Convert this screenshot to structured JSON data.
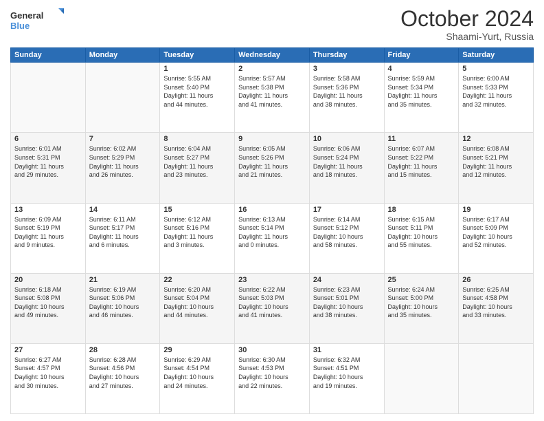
{
  "header": {
    "logo_line1": "General",
    "logo_line2": "Blue",
    "month": "October 2024",
    "location": "Shaami-Yurt, Russia"
  },
  "days_of_week": [
    "Sunday",
    "Monday",
    "Tuesday",
    "Wednesday",
    "Thursday",
    "Friday",
    "Saturday"
  ],
  "weeks": [
    [
      {
        "day": "",
        "content": ""
      },
      {
        "day": "",
        "content": ""
      },
      {
        "day": "1",
        "content": "Sunrise: 5:55 AM\nSunset: 5:40 PM\nDaylight: 11 hours\nand 44 minutes."
      },
      {
        "day": "2",
        "content": "Sunrise: 5:57 AM\nSunset: 5:38 PM\nDaylight: 11 hours\nand 41 minutes."
      },
      {
        "day": "3",
        "content": "Sunrise: 5:58 AM\nSunset: 5:36 PM\nDaylight: 11 hours\nand 38 minutes."
      },
      {
        "day": "4",
        "content": "Sunrise: 5:59 AM\nSunset: 5:34 PM\nDaylight: 11 hours\nand 35 minutes."
      },
      {
        "day": "5",
        "content": "Sunrise: 6:00 AM\nSunset: 5:33 PM\nDaylight: 11 hours\nand 32 minutes."
      }
    ],
    [
      {
        "day": "6",
        "content": "Sunrise: 6:01 AM\nSunset: 5:31 PM\nDaylight: 11 hours\nand 29 minutes."
      },
      {
        "day": "7",
        "content": "Sunrise: 6:02 AM\nSunset: 5:29 PM\nDaylight: 11 hours\nand 26 minutes."
      },
      {
        "day": "8",
        "content": "Sunrise: 6:04 AM\nSunset: 5:27 PM\nDaylight: 11 hours\nand 23 minutes."
      },
      {
        "day": "9",
        "content": "Sunrise: 6:05 AM\nSunset: 5:26 PM\nDaylight: 11 hours\nand 21 minutes."
      },
      {
        "day": "10",
        "content": "Sunrise: 6:06 AM\nSunset: 5:24 PM\nDaylight: 11 hours\nand 18 minutes."
      },
      {
        "day": "11",
        "content": "Sunrise: 6:07 AM\nSunset: 5:22 PM\nDaylight: 11 hours\nand 15 minutes."
      },
      {
        "day": "12",
        "content": "Sunrise: 6:08 AM\nSunset: 5:21 PM\nDaylight: 11 hours\nand 12 minutes."
      }
    ],
    [
      {
        "day": "13",
        "content": "Sunrise: 6:09 AM\nSunset: 5:19 PM\nDaylight: 11 hours\nand 9 minutes."
      },
      {
        "day": "14",
        "content": "Sunrise: 6:11 AM\nSunset: 5:17 PM\nDaylight: 11 hours\nand 6 minutes."
      },
      {
        "day": "15",
        "content": "Sunrise: 6:12 AM\nSunset: 5:16 PM\nDaylight: 11 hours\nand 3 minutes."
      },
      {
        "day": "16",
        "content": "Sunrise: 6:13 AM\nSunset: 5:14 PM\nDaylight: 11 hours\nand 0 minutes."
      },
      {
        "day": "17",
        "content": "Sunrise: 6:14 AM\nSunset: 5:12 PM\nDaylight: 10 hours\nand 58 minutes."
      },
      {
        "day": "18",
        "content": "Sunrise: 6:15 AM\nSunset: 5:11 PM\nDaylight: 10 hours\nand 55 minutes."
      },
      {
        "day": "19",
        "content": "Sunrise: 6:17 AM\nSunset: 5:09 PM\nDaylight: 10 hours\nand 52 minutes."
      }
    ],
    [
      {
        "day": "20",
        "content": "Sunrise: 6:18 AM\nSunset: 5:08 PM\nDaylight: 10 hours\nand 49 minutes."
      },
      {
        "day": "21",
        "content": "Sunrise: 6:19 AM\nSunset: 5:06 PM\nDaylight: 10 hours\nand 46 minutes."
      },
      {
        "day": "22",
        "content": "Sunrise: 6:20 AM\nSunset: 5:04 PM\nDaylight: 10 hours\nand 44 minutes."
      },
      {
        "day": "23",
        "content": "Sunrise: 6:22 AM\nSunset: 5:03 PM\nDaylight: 10 hours\nand 41 minutes."
      },
      {
        "day": "24",
        "content": "Sunrise: 6:23 AM\nSunset: 5:01 PM\nDaylight: 10 hours\nand 38 minutes."
      },
      {
        "day": "25",
        "content": "Sunrise: 6:24 AM\nSunset: 5:00 PM\nDaylight: 10 hours\nand 35 minutes."
      },
      {
        "day": "26",
        "content": "Sunrise: 6:25 AM\nSunset: 4:58 PM\nDaylight: 10 hours\nand 33 minutes."
      }
    ],
    [
      {
        "day": "27",
        "content": "Sunrise: 6:27 AM\nSunset: 4:57 PM\nDaylight: 10 hours\nand 30 minutes."
      },
      {
        "day": "28",
        "content": "Sunrise: 6:28 AM\nSunset: 4:56 PM\nDaylight: 10 hours\nand 27 minutes."
      },
      {
        "day": "29",
        "content": "Sunrise: 6:29 AM\nSunset: 4:54 PM\nDaylight: 10 hours\nand 24 minutes."
      },
      {
        "day": "30",
        "content": "Sunrise: 6:30 AM\nSunset: 4:53 PM\nDaylight: 10 hours\nand 22 minutes."
      },
      {
        "day": "31",
        "content": "Sunrise: 6:32 AM\nSunset: 4:51 PM\nDaylight: 10 hours\nand 19 minutes."
      },
      {
        "day": "",
        "content": ""
      },
      {
        "day": "",
        "content": ""
      }
    ]
  ]
}
